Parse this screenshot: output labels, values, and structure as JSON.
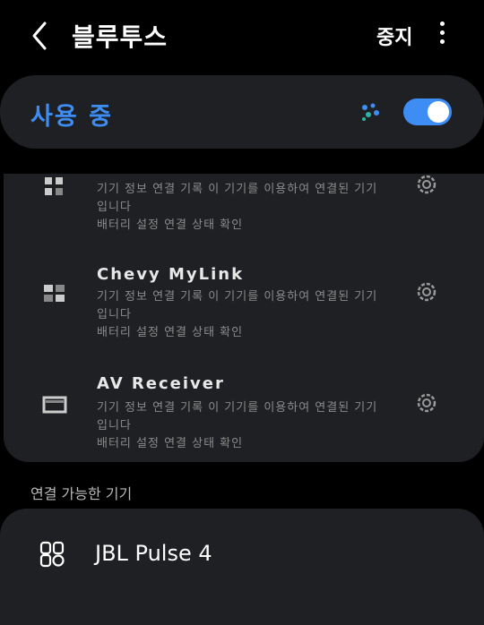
{
  "header": {
    "title": "블루투스",
    "stop_label": "중지",
    "back_icon": "chevron-left-icon",
    "more_icon": "more-vertical-icon"
  },
  "master_toggle": {
    "label": "사용 중",
    "enabled": true,
    "accent_color": "#3d8df5"
  },
  "paired_devices": [
    {
      "name": "",
      "desc_line1": "기기 정보 연결 기록 이 기기를 이용하여 연결된 기기입니다",
      "desc_line2": "배터리 설정 연결 상태 확인",
      "icon": "device-icon"
    },
    {
      "name": "Chevy MyLink",
      "desc_line1": "기기 정보 연결 기록 이 기기를 이용하여 연결된 기기입니다",
      "desc_line2": "배터리 설정 연결 상태 확인",
      "icon": "car-device-icon"
    },
    {
      "name": "AV Receiver",
      "desc_line1": "기기 정보 연결 기록 이 기기를 이용하여 연결된 기기입니다",
      "desc_line2": "배터리 설정 연결 상태 확인",
      "icon": "monitor-icon"
    }
  ],
  "available_section": {
    "label": "연결 가능한 기기"
  },
  "available_devices": [
    {
      "name": "JBL Pulse 4",
      "icon": "speaker-group-icon"
    }
  ]
}
